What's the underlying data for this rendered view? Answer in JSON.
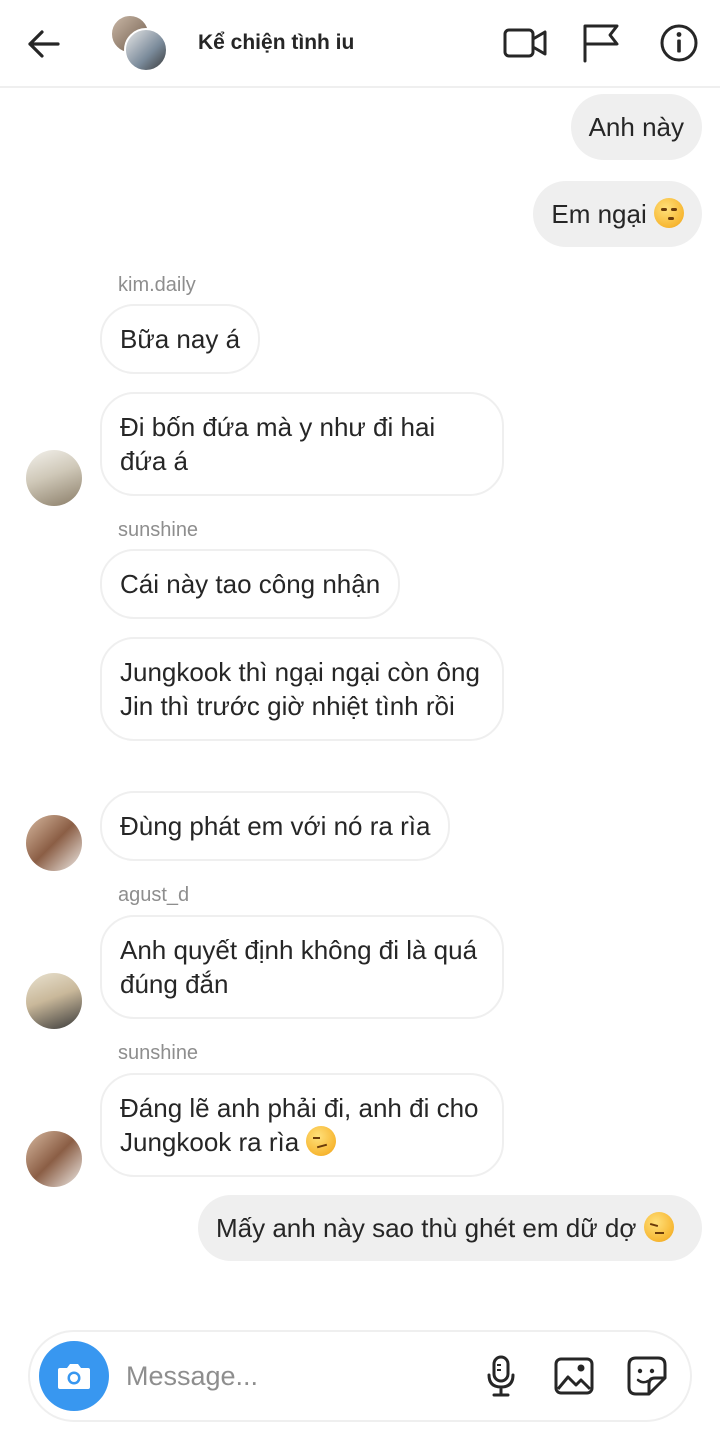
{
  "header": {
    "title": "Kể chiện tình iu",
    "icons": [
      "back-arrow-icon",
      "video-call-icon",
      "flag-icon",
      "info-icon"
    ]
  },
  "messages": [
    {
      "type": "outgoing",
      "text": "Anh này"
    },
    {
      "type": "outgoing",
      "text": "Em ngại",
      "emoji": "kissing-closed-eyes-emoji"
    },
    {
      "type": "sender",
      "text": "kim.daily"
    },
    {
      "type": "incoming",
      "text": "Bữa nay á"
    },
    {
      "type": "incoming",
      "text": "Đi bốn đứa mà y như đi hai đứa á"
    },
    {
      "type": "sender",
      "text": "sunshine"
    },
    {
      "type": "incoming",
      "text": "Cái này tao công nhận"
    },
    {
      "type": "incoming",
      "text": "Jungkook thì ngại ngại còn ông Jin thì trước giờ nhiệt tình rồi"
    },
    {
      "type": "incoming",
      "text": "Đùng phát em với nó ra rìa"
    },
    {
      "type": "sender",
      "text": "agust_d"
    },
    {
      "type": "incoming",
      "text": "Anh quyết định không đi là quá đúng đắn"
    },
    {
      "type": "sender",
      "text": "sunshine"
    },
    {
      "type": "incoming",
      "text": "Đáng lẽ anh phải đi, anh đi cho Jungkook ra rìa",
      "emoji": "smirk-emoji"
    },
    {
      "type": "outgoing",
      "text": "Mấy anh này sao thù ghét em dữ dợ",
      "emoji": "pensive-emoji"
    }
  ],
  "composer": {
    "placeholder": "Message...",
    "icons": [
      "camera-icon",
      "microphone-icon",
      "gallery-icon",
      "sticker-icon"
    ]
  },
  "colors": {
    "accent": "#3897f0",
    "outgoing_bubble": "#efefef",
    "incoming_border": "#efefef",
    "muted_text": "#8e8e8e"
  }
}
